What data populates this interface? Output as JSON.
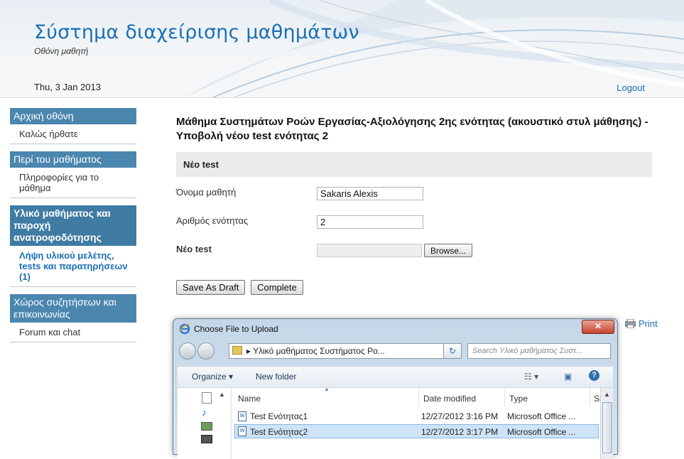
{
  "header": {
    "title": "Σύστημα διαχείρισης μαθημάτων",
    "subtitle": "Οθόνη μαθητή",
    "date": "Thu, 3 Jan 2013",
    "logout": "Logout"
  },
  "sidebar": {
    "sections": [
      {
        "head": "Αρχική οθόνη",
        "item": "Καλώς ήρθατε"
      },
      {
        "head": "Περί του μαθήματος",
        "item": "Πληροφορίες για το μάθημα"
      },
      {
        "head": "Υλικό μαθήματος και παροχή ανατροφοδότησης",
        "item": "Λήψη υλικού μελέτης, tests και παρατηρήσεων (1)"
      },
      {
        "head": "Χώρος συζητήσεων και επικοινωνίας",
        "item": "Forum και chat"
      }
    ]
  },
  "main": {
    "heading": "Μάθημα Συστημάτων Ροών Εργασίας-Αξιολόγησης 2ης ενότητας (ακουστικό στυλ μάθησης) - Υποβολή νέου test ενότητας 2",
    "section_title": "Νέο test",
    "fields": {
      "name_label": "Όνομα μαθητή",
      "name_value": "Sakaris Alexis",
      "unit_label": "Αριθμός ενότητας",
      "unit_value": "2",
      "file_label": "Νέο test",
      "browse_label": "Browse..."
    },
    "buttons": {
      "draft": "Save As Draft",
      "complete": "Complete"
    },
    "print": "Print"
  },
  "dialog": {
    "title": "Choose File to Upload",
    "close": "✕",
    "address": "Υλικό μαθήματος Συστήματος Ρο...",
    "search_placeholder": "Search Υλικό μαθήματος Συστ...",
    "organize": "Organize ▾",
    "new_folder": "New folder",
    "columns": {
      "name": "Name",
      "date": "Date modified",
      "type": "Type",
      "size": "Si"
    },
    "files": [
      {
        "name": "Test Ενότητας1",
        "date": "12/27/2012 3:16 PM",
        "type": "Microsoft Office ..."
      },
      {
        "name": "Test Ενότητας2",
        "date": "12/27/2012 3:17 PM",
        "type": "Microsoft Office ..."
      }
    ]
  }
}
